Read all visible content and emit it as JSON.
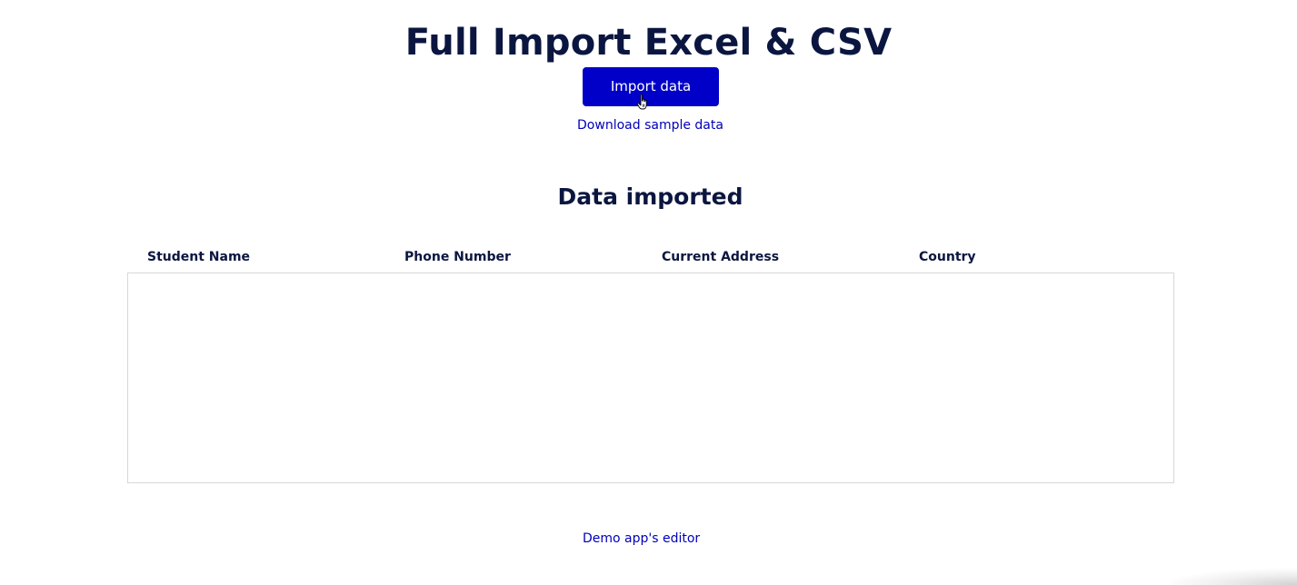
{
  "header": {
    "title": "Full Import Excel & CSV"
  },
  "actions": {
    "import_label": "Import data",
    "download_label": "Download sample data"
  },
  "section": {
    "title": "Data imported"
  },
  "table": {
    "columns": [
      "Student Name",
      "Phone Number",
      "Current Address",
      "Country"
    ],
    "rows": []
  },
  "footer": {
    "editor_link": "Demo app's editor"
  },
  "colors": {
    "primary": "#0000c8",
    "link": "#0000b8",
    "text": "#0b1640",
    "border": "#d7d7dc"
  },
  "icons": {
    "cursor": "hand-pointer-icon"
  }
}
